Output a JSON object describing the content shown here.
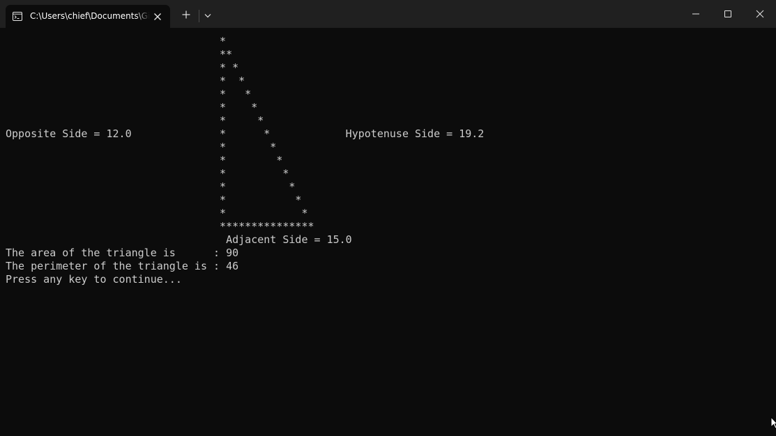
{
  "window": {
    "tab_title": "C:\\Users\\chief\\Documents\\GitHub",
    "tab_icon": "terminal-icon",
    "buttons": {
      "new_tab": "plus-icon",
      "dropdown": "chevron-down-icon",
      "minimize": "minimize-icon",
      "maximize": "maximize-icon",
      "close": "close-icon"
    }
  },
  "terminal": {
    "lines": [
      "                                  *",
      "                                  **",
      "                                  * *",
      "                                  *  *",
      "                                  *   *",
      "                                  *    *",
      "                                  *     *",
      "Opposite Side = 12.0              *      *            Hypotenuse Side = 19.2",
      "                                  *       *",
      "                                  *        *",
      "                                  *         *",
      "                                  *          *",
      "                                  *           *",
      "                                  *            *",
      "                                  ***************",
      "                                   Adjacent Side = 15.0",
      "The area of the triangle is      : 90",
      "The perimeter of the triangle is : 46",
      "Press any key to continue..."
    ]
  },
  "colors": {
    "terminal_bg": "#0c0c0c",
    "titlebar_bg": "#202020",
    "text": "#cccccc"
  }
}
